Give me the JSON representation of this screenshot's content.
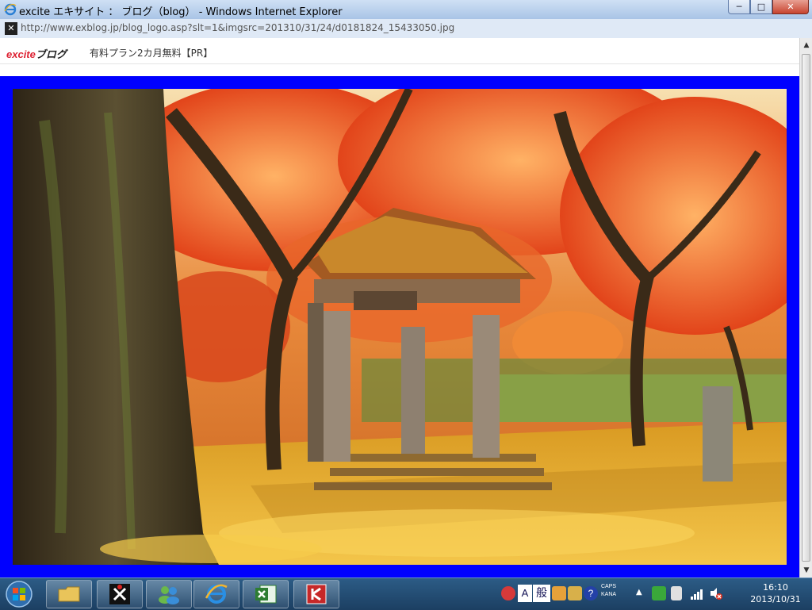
{
  "window": {
    "title": "excite エキサイト ： ブログ（blog） - Windows Internet Explorer",
    "url": "http://www.exblog.jp/blog_logo.asp?slt=1&imgsrc=201310/31/24/d0181824_15433050.jpg",
    "controls": {
      "minimize": "─",
      "maximize": "□",
      "close": "✕"
    }
  },
  "page": {
    "logo_prefix": "excite",
    "logo_suffix": "ブログ",
    "promo": "有料プラン2カ月無料【PR】"
  },
  "colors": {
    "frame": "#0000ff"
  },
  "taskbar": {
    "start_icon": "windows-orb-icon",
    "buttons": [
      "folder-icon",
      "app-x-icon",
      "messenger-icon",
      "ie-icon",
      "excel-icon",
      "app-k-icon"
    ],
    "tray": {
      "ime_mode": "A",
      "ime_kana": "般",
      "caps": "CAPS",
      "kana": "KANA",
      "time": "16:10",
      "date": "2013/10/31"
    }
  }
}
